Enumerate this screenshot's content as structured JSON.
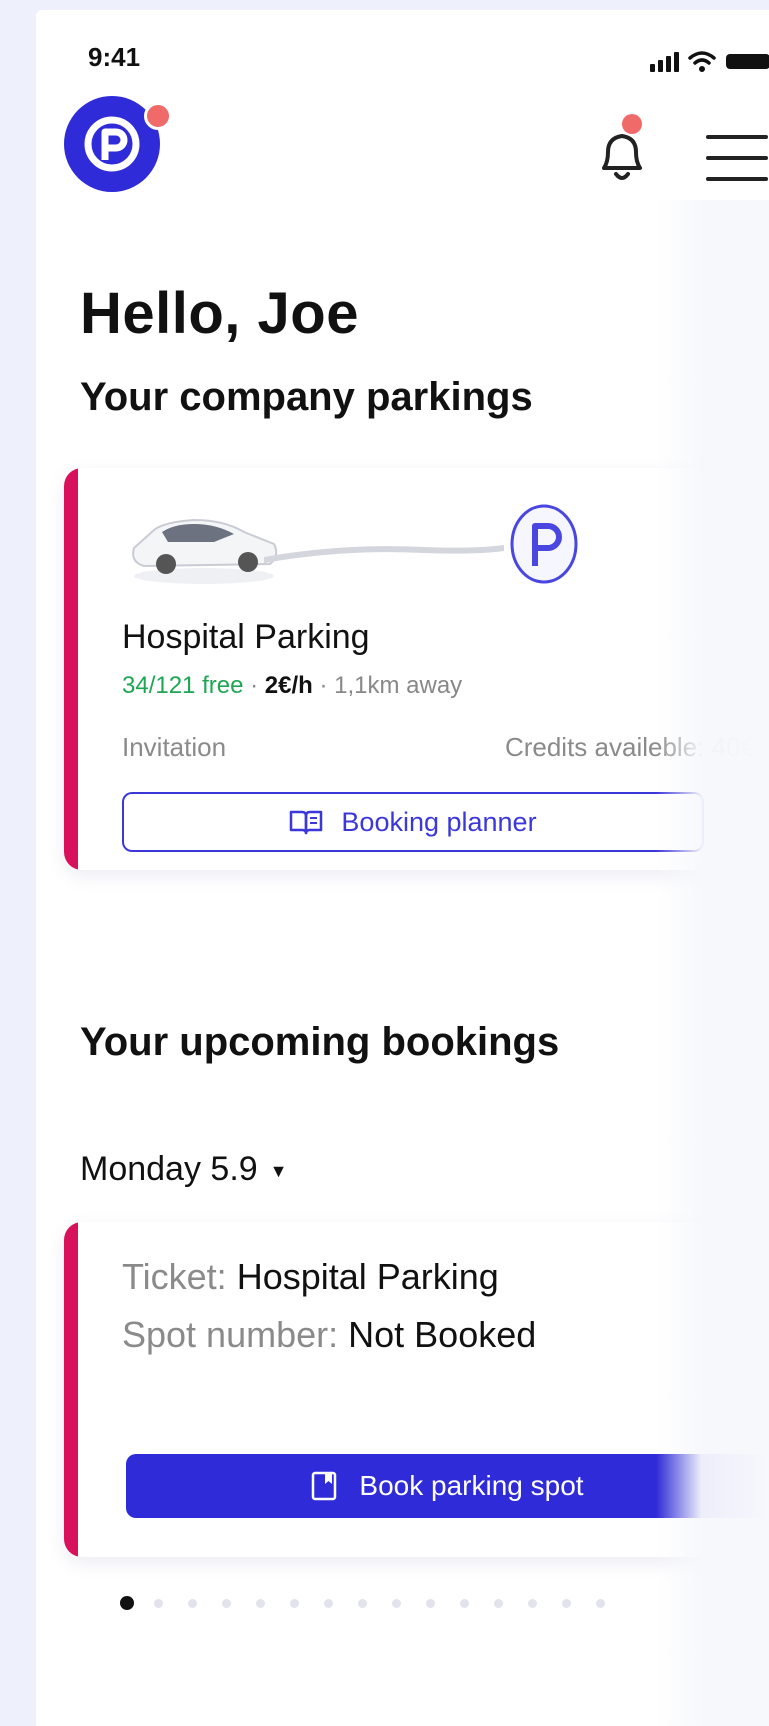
{
  "status_bar": {
    "time": "9:41"
  },
  "header": {
    "notification_badge": true
  },
  "greeting": "Hello, Joe",
  "company_parkings": {
    "title": "Your company parkings",
    "card": {
      "name": "Hospital Parking",
      "free": "34/121 free",
      "separator1": " · ",
      "price": "2€/h",
      "separator2": " · ",
      "distance": "1,1km away",
      "access_type": "Invitation",
      "credits": "Credits availeble: 40€",
      "planner_button": "Booking planner"
    }
  },
  "upcoming_bookings": {
    "title": "Your upcoming bookings",
    "selected_day": "Monday 5.9",
    "booking": {
      "ticket_label": "Ticket:",
      "ticket_value": "Hospital Parking",
      "spot_label": "Spot number:",
      "spot_value": "Not Booked",
      "book_button": "Book parking spot"
    }
  },
  "pagination": {
    "total": 15,
    "active_index": 0
  },
  "colors": {
    "brand": "#2f2bd8",
    "accent": "#d8115d",
    "free": "#1ea655",
    "badge": "#f06a6a"
  }
}
